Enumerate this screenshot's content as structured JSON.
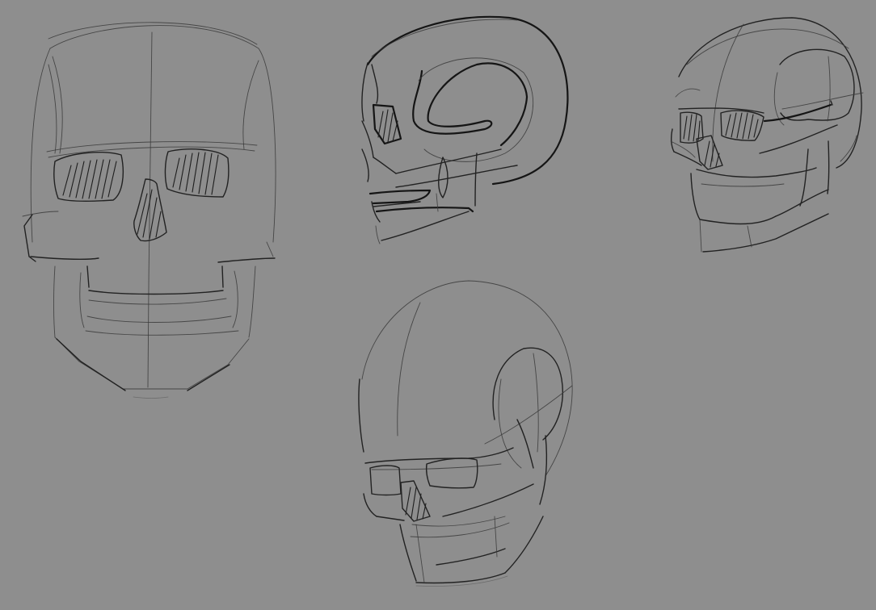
{
  "canvas": {
    "background": "#8e8e8e",
    "stroke_color": "#1a1a1a"
  },
  "sketches": [
    {
      "name": "skull-front-view"
    },
    {
      "name": "skull-side-view"
    },
    {
      "name": "skull-three-quarter-view"
    },
    {
      "name": "skull-low-angle-view"
    }
  ]
}
